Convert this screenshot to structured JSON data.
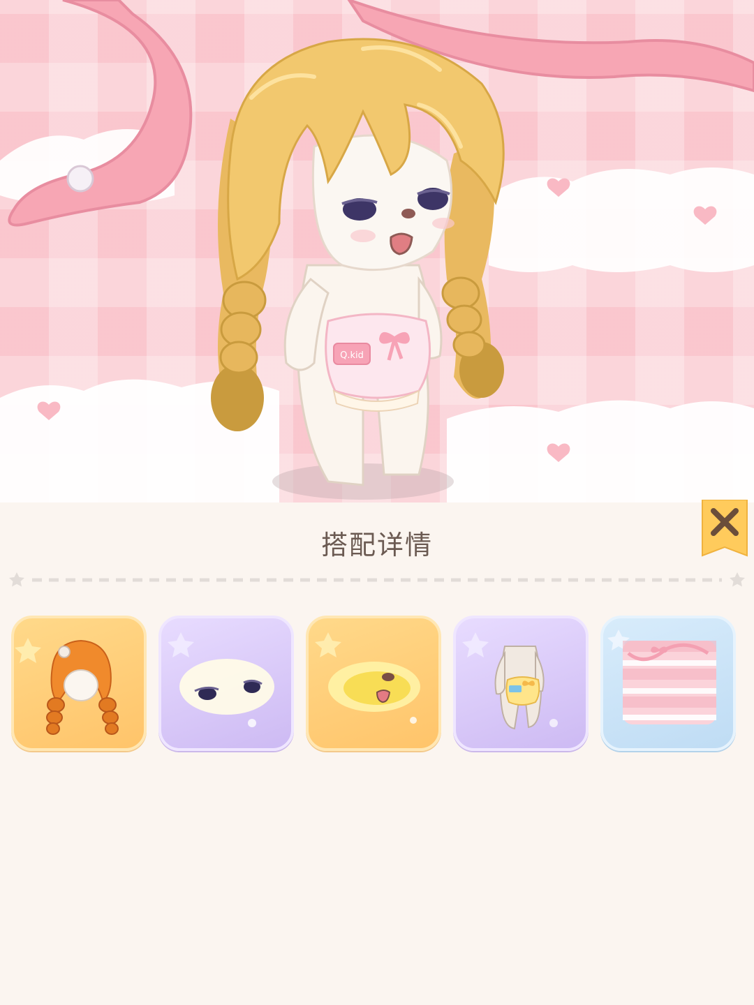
{
  "panel": {
    "title": "搭配详情",
    "close_icon": "close-x-icon"
  },
  "preview": {
    "character": "bear-character-preview",
    "clothing_tag": "Q.kid"
  },
  "items": [
    {
      "name": "hair-item",
      "icon": "orange-curly-braided-hair-icon",
      "rarity_color": "#ffc46a"
    },
    {
      "name": "eyes-item",
      "icon": "sleepy-eyes-icon",
      "rarity_color": "#cdbaf3"
    },
    {
      "name": "mouth-item",
      "icon": "open-mouth-snout-icon",
      "rarity_color": "#ffc46a"
    },
    {
      "name": "outfit-item",
      "icon": "bear-body-apron-outfit-icon",
      "rarity_color": "#cdbaf3"
    },
    {
      "name": "background-item",
      "icon": "pink-gingham-ribbon-background-icon",
      "rarity_color": "#bfdcf4"
    }
  ],
  "colors": {
    "accent": "#ffc95a",
    "title_text": "#6b5a52",
    "panel_bg": "#fbf5f0"
  }
}
